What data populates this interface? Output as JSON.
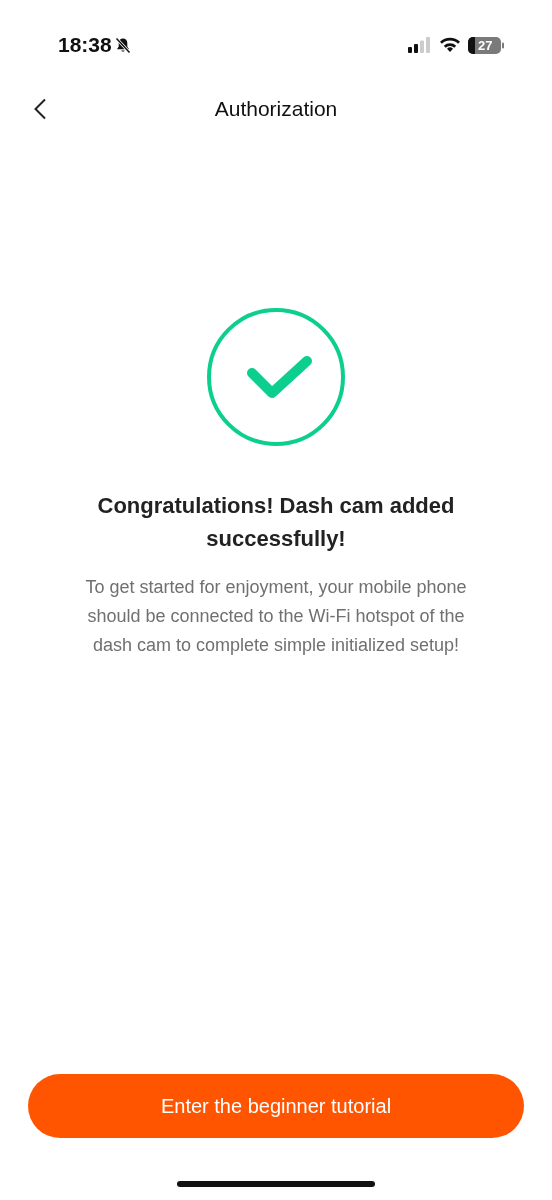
{
  "status_bar": {
    "time": "18:38",
    "battery": "27"
  },
  "nav": {
    "title": "Authorization"
  },
  "heading": "Congratulations! Dash cam added successfully!",
  "message": "To get started for enjoyment, your mobile phone should be connected to the Wi‑Fi hotspot of the dash cam to complete simple initialized setup!",
  "button": {
    "label": "Enter the beginner tutorial"
  }
}
